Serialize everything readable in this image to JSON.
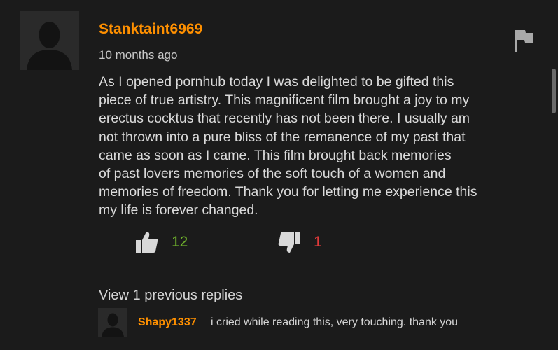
{
  "comment": {
    "username": "Stanktaint6969",
    "timestamp": "10 months ago",
    "text": "As I opened pornhub today I was delighted to be gifted this\npiece of true artistry. This magnificent film brought a joy to my\nerectus cocktus that recently has not been there. I usually am\nnot thrown into a pure bliss of the remanence of my past that\ncame as soon as I came. This film brought back memories\nof past lovers memories of the soft touch of a women and\nmemories of freedom. Thank you for letting me experience this\nmy life is forever changed.",
    "likes": "12",
    "dislikes": "1",
    "avatar_icon": "default-user-silhouette-icon",
    "flag_icon": "flag-icon",
    "like_icon": "thumbs-up-icon",
    "dislike_icon": "thumbs-down-icon"
  },
  "replies": {
    "view_label": "View 1 previous replies",
    "items": [
      {
        "username": "Shapy1337",
        "text": "i cried while reading this, very touching. thank you",
        "avatar_icon": "default-user-silhouette-icon"
      }
    ]
  },
  "colors": {
    "background": "#1b1b1b",
    "username": "#ff9000",
    "like": "#6fb12c",
    "dislike": "#e03a3a",
    "text": "#dadada"
  }
}
